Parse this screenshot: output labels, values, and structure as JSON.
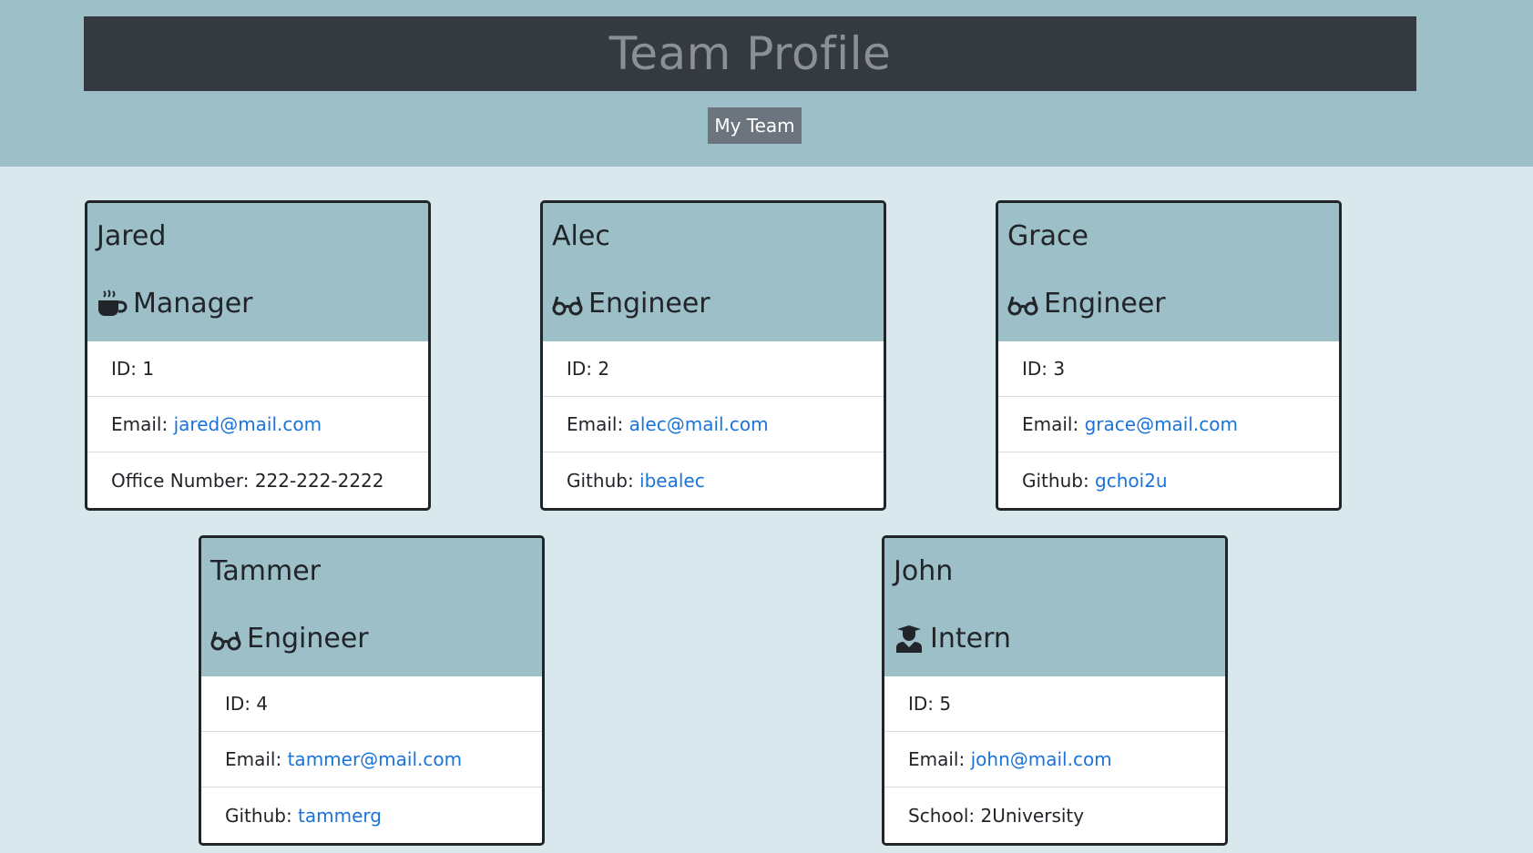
{
  "header": {
    "title": "Team Profile",
    "button_label": "My Team"
  },
  "cards": [
    {
      "name": "Jared",
      "role": "Manager",
      "icon": "coffee-icon",
      "id_label": "ID: 1",
      "email_label": "Email: ",
      "email": "jared@mail.com",
      "extra_label": "Office Number: 222-222-2222",
      "extra_link": ""
    },
    {
      "name": "Alec",
      "role": "Engineer",
      "icon": "glasses-icon",
      "id_label": "ID: 2",
      "email_label": "Email: ",
      "email": "alec@mail.com",
      "extra_label": "Github: ",
      "extra_link": "ibealec"
    },
    {
      "name": "Grace",
      "role": "Engineer",
      "icon": "glasses-icon",
      "id_label": "ID: 3",
      "email_label": "Email: ",
      "email": "grace@mail.com",
      "extra_label": "Github: ",
      "extra_link": "gchoi2u"
    },
    {
      "name": "Tammer",
      "role": "Engineer",
      "icon": "glasses-icon",
      "id_label": "ID: 4",
      "email_label": "Email: ",
      "email": "tammer@mail.com",
      "extra_label": "Github: ",
      "extra_link": "tammerg"
    },
    {
      "name": "John",
      "role": "Intern",
      "icon": "graduate-icon",
      "id_label": "ID: 5",
      "email_label": "Email: ",
      "email": "john@mail.com",
      "extra_label": "School: 2University",
      "extra_link": ""
    }
  ]
}
